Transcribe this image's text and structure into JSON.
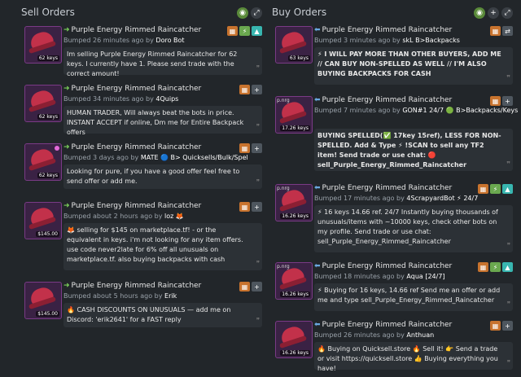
{
  "sell": {
    "title": "Sell Orders",
    "items": [
      {
        "title": "Purple Energy Rimmed Raincatcher",
        "price": "62 keys",
        "bumped": "Bumped 26 minutes ago by",
        "user": "Doro Bot",
        "desc": "Im selling Purple Energy Rimmed Raincatcher for 62 keys. I currently have 1. Please send trade with the correct amount!"
      },
      {
        "title": "Purple Energy Rimmed Raincatcher",
        "price": "62 keys",
        "bumped": "Bumped 34 minutes ago by",
        "user": "4Quips",
        "desc": "HUMAN TRADER, Will always beat the bots in price. INSTANT ACCEPT if online, Dm me for Entire Backpack offers"
      },
      {
        "title": "Purple Energy Rimmed Raincatcher",
        "price": "62 keys",
        "bumped": "Bumped 3 days ago by",
        "user": "MATE 🔵 B> Quicksells/Bulk/Spel",
        "desc": "Looking for pure, if you have a good offer feel free to send offer or add me."
      },
      {
        "title": "Purple Energy Rimmed Raincatcher",
        "price": "$145.00",
        "bumped": "Bumped about 2 hours ago by",
        "user": "loz 🦊",
        "desc": "🦊 selling for $145 on marketplace.tf! - or the equivalent in keys. i'm not looking for any item offers. use code never2late for 6% off all unusuals on marketplace.tf. also buying backpacks with cash"
      },
      {
        "title": "Purple Energy Rimmed Raincatcher",
        "price": "$145.00",
        "bumped": "Bumped about 5 hours ago by",
        "user": "Erik",
        "desc": "🔥 CASH DISCOUNTS ON UNUSUALS — add me on Discord: 'erik2641' for a FAST reply"
      }
    ]
  },
  "buy": {
    "title": "Buy Orders",
    "items": [
      {
        "title": "Purple Energy Rimmed Raincatcher",
        "price": "63 keys",
        "bumped": "Bumped 3 minutes ago by",
        "user": "skL B>Backpacks",
        "desc": "⚡ I WILL PAY MORE THAN OTHER BUYERS, ADD ME // CAN BUY NON-SPELLED AS WELL // I'M ALSO BUYING BACKPACKS FOR CASH",
        "bold": true
      },
      {
        "title": "Purple Energy Rimmed Raincatcher",
        "price": "17.26 keys",
        "bumped": "Bumped 7 minutes ago by",
        "user": "GON#1 24/7 🟢 B>Backpacks/Keys",
        "desc": "BUYING SPELLED(✅ 17key 15ref), LESS FOR NON-SPELLED. Add & Type ⚡ !SCAN to sell any TF2 item! Send trade or use chat: 🔴 sell_Purple_Energy_Rimmed_Raincatcher",
        "bold": true
      },
      {
        "title": "Purple Energy Rimmed Raincatcher",
        "price": "16.26 keys",
        "bumped": "Bumped 17 minutes ago by",
        "user": "4ScrapyardBot ⚡ 24/7",
        "desc": "⚡ 16 keys 14.66 ref. 24/7 Instantly buying thousands of unusuals/items with ~10000 keys, check other bots on my profile. Send trade or use chat: sell_Purple_Energy_Rimmed_Raincatcher"
      },
      {
        "title": "Purple Energy Rimmed Raincatcher",
        "price": "16.26 keys",
        "bumped": "Bumped 18 minutes ago by",
        "user": "Aqua [24/7]",
        "desc": "⚡ Buying for 16 keys, 14.66 ref Send me an offer or add me and type sell_Purple_Energy_Rimmed_Raincatcher"
      },
      {
        "title": "Purple Energy Rimmed Raincatcher",
        "price": "16.26 keys",
        "bumped": "Bumped 26 minutes ago by",
        "user": "Anthuan",
        "desc": "🔥 Buying on Quicksell.store 🔥 Sell it! 👉 Send a trade or visit https://quicksell.store 👍 Buying everything you have!"
      }
    ]
  }
}
